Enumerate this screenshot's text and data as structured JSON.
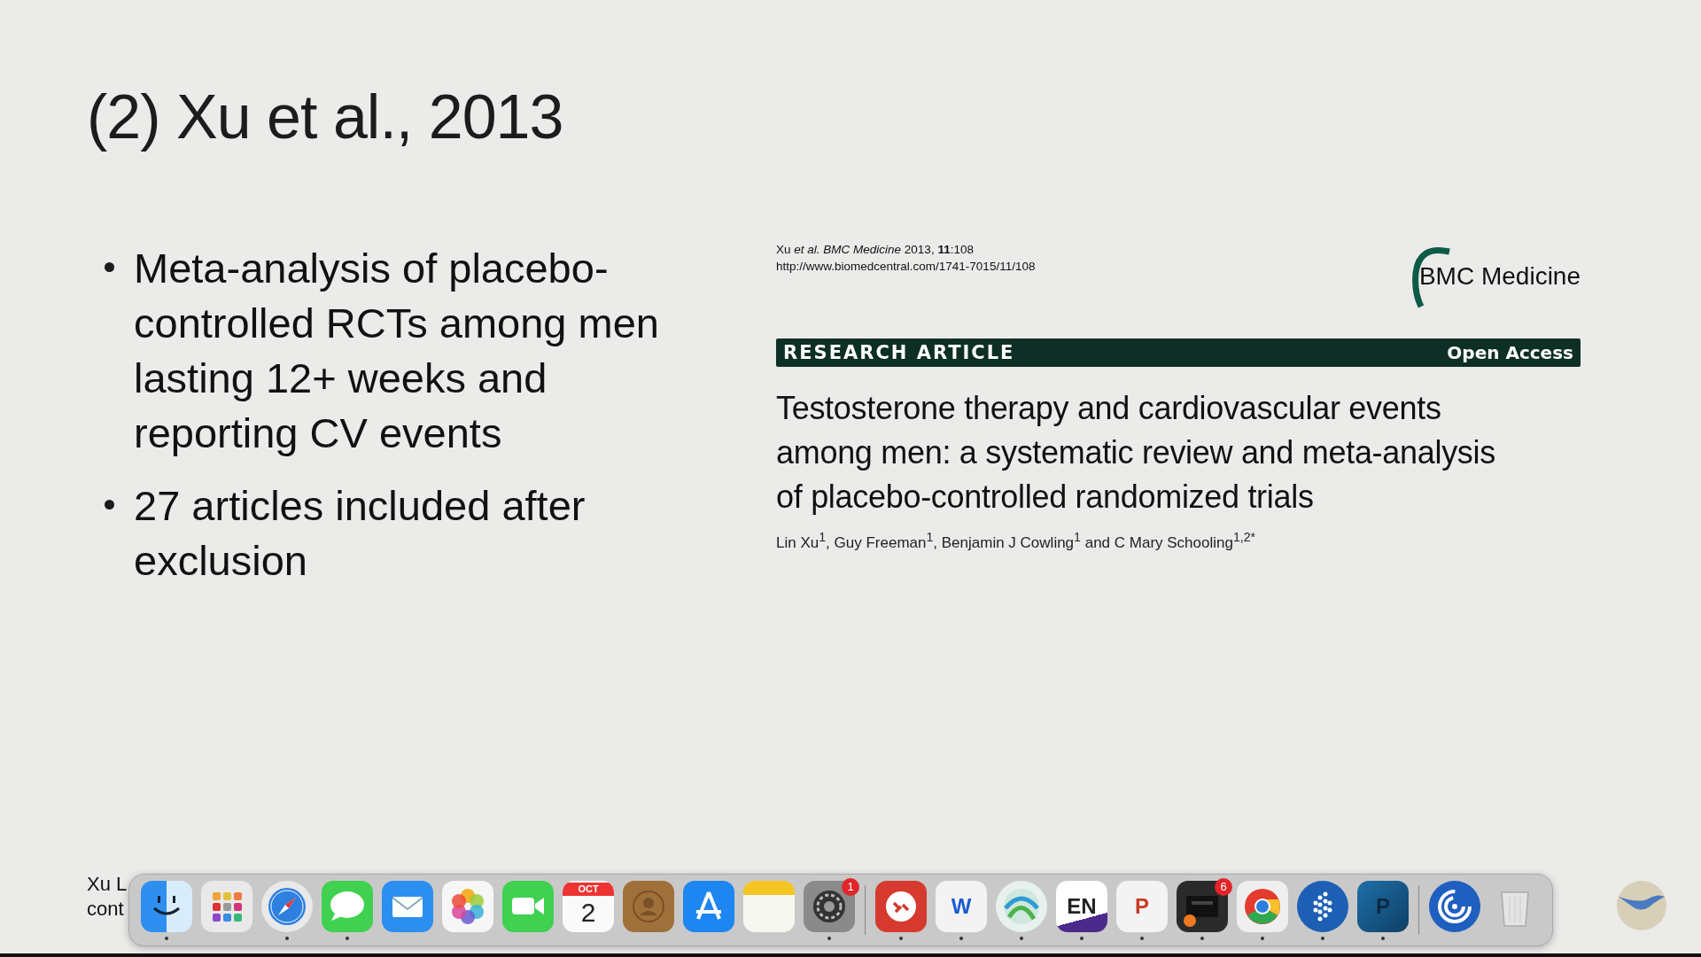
{
  "slide": {
    "title": "(2) Xu et al., 2013",
    "bullets": [
      "Meta-analysis of placebo-controlled RCTs among men lasting 12+ weeks and reporting CV events",
      "27 articles included after exclusion"
    ],
    "paper": {
      "citation": "Xu *et al.* *BMC Medicine* 2013, **11**:108",
      "url": "http://www.biomedcentral.com/1741-7015/11/108",
      "journal": "BMC Medicine",
      "article_type": "RESEARCH ARTICLE",
      "access": "Open Access",
      "title": "Testosterone therapy and cardiovascular events among men: a systematic review and meta-analysis of placebo-controlled randomized trials",
      "authors": "Lin Xu$^{1}$, Guy Freeman$^{1}$, Benjamin J Cowling$^{1}$ and C Mary Schooling$^{1,2*}$"
    },
    "footnote": [
      "Xu L",
      "cont"
    ]
  },
  "dock": [
    {
      "running": true
    },
    {
      "running": false
    },
    {
      "running": true
    },
    {
      "running": true
    },
    {
      "running": false
    },
    {
      "running": false
    },
    {
      "running": false
    },
    {
      "running": false,
      "header": "OCT",
      "label": "2"
    },
    {
      "running": false
    },
    {
      "running": false
    },
    {
      "running": false
    },
    {
      "running": true,
      "badge": "1"
    },
    {
      "running": true
    },
    {
      "running": true,
      "label": "W"
    },
    {
      "running": true
    },
    {
      "running": true,
      "label": "EN"
    },
    {
      "running": true,
      "label": "P"
    },
    {
      "running": true,
      "badge": "6"
    },
    {
      "running": true
    },
    {
      "running": true
    },
    {
      "running": true,
      "label": "P"
    },
    {
      "running": false
    },
    {
      "running": false
    }
  ]
}
